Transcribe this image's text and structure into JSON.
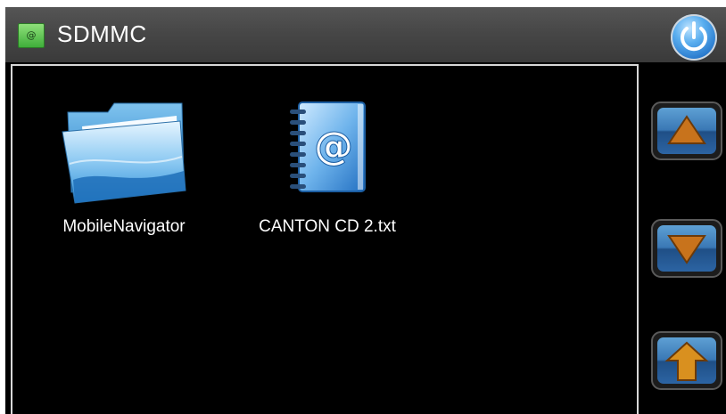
{
  "titlebar": {
    "title": "SDMMC",
    "app_icon": "address-book-icon",
    "power_icon": "power-icon"
  },
  "files": [
    {
      "name": "MobileNavigator",
      "icon": "folder-icon"
    },
    {
      "name": "CANTON CD 2.txt",
      "icon": "text-file-icon"
    }
  ],
  "side_buttons": [
    {
      "name": "scroll-up-button",
      "icon": "triangle-up-icon"
    },
    {
      "name": "scroll-down-button",
      "icon": "triangle-down-icon"
    },
    {
      "name": "parent-folder-button",
      "icon": "arrow-up-icon"
    }
  ],
  "colors": {
    "background": "#000000",
    "titlebar": "#474747",
    "button_blue": "#3a78b5",
    "arrow_orange": "#c8731c"
  }
}
